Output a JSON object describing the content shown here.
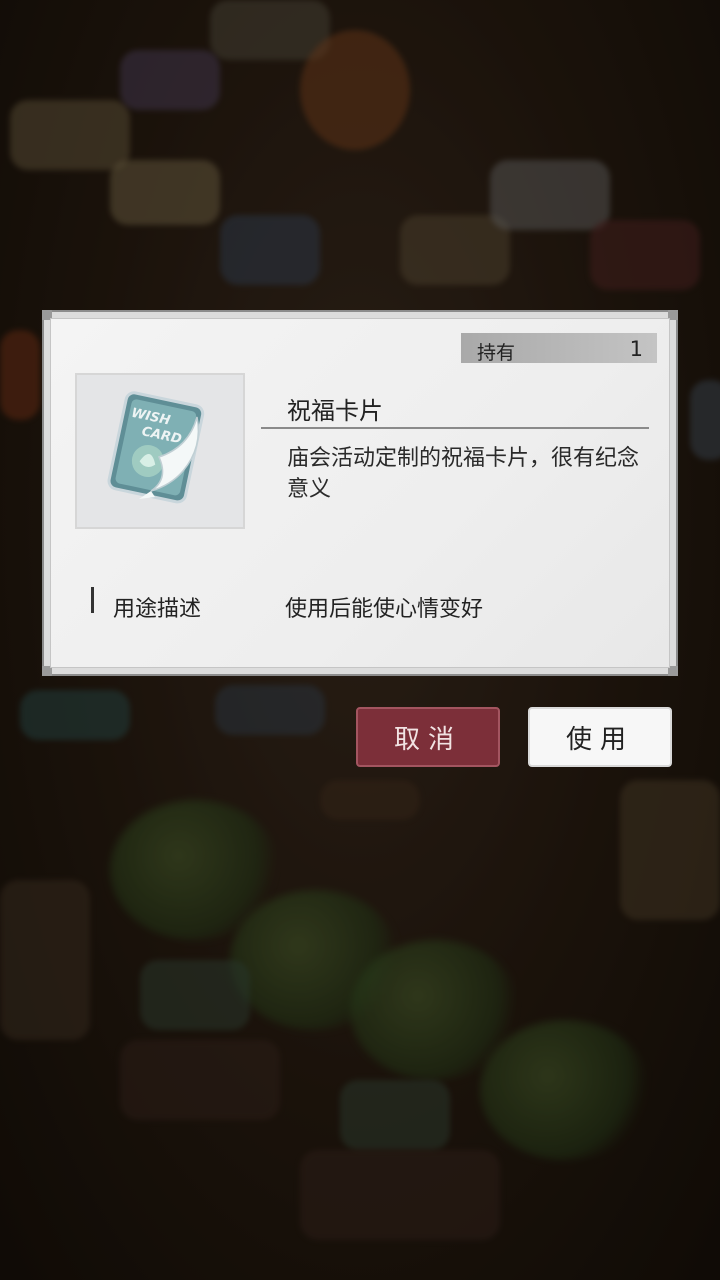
{
  "dialog": {
    "owned_label": "持有",
    "owned_count": "1",
    "item_name": "祝福卡片",
    "item_description": "庙会活动定制的祝福卡片，很有纪念意义",
    "usage_label": "用途描述",
    "usage_text": "使用后能使心情变好",
    "item_icon": "wish-card-koi-icon",
    "icon_text": [
      "WISH",
      "CARD"
    ]
  },
  "buttons": {
    "cancel_label": "取消",
    "use_label": "使用"
  },
  "colors": {
    "cancel_button": "#7c2f39",
    "use_button": "#f7f7f7",
    "dialog_background": "#eeeeee"
  }
}
